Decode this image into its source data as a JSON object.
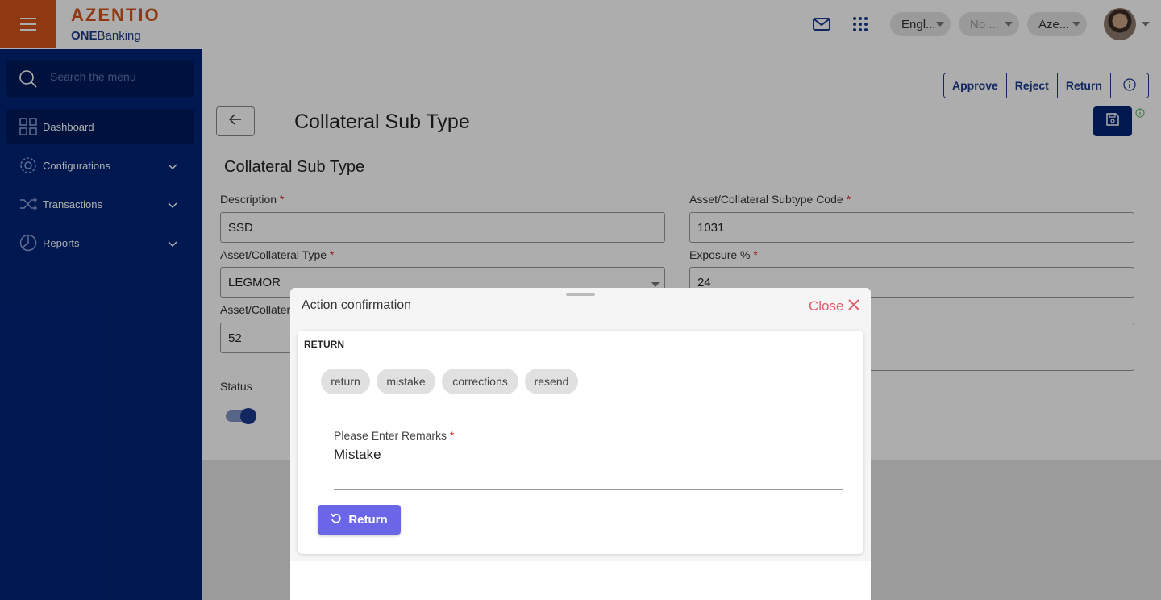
{
  "header": {
    "logo_main": "AZENTIO",
    "logo_sub_bold": "ONE",
    "logo_sub": "Banking",
    "icons": [
      "menu-icon",
      "mail-icon",
      "apps-grid-icon"
    ],
    "language": "Engl...",
    "no_dropdown": "No ...",
    "entity": "Aze..."
  },
  "sidebar": {
    "search_placeholder": "Search the menu",
    "items": [
      {
        "label": "Dashboard",
        "icon": "dashboard-icon"
      },
      {
        "label": "Configurations",
        "icon": "gear-icon"
      },
      {
        "label": "Transactions",
        "icon": "shuffle-icon"
      },
      {
        "label": "Reports",
        "icon": "pie-chart-icon"
      }
    ]
  },
  "main": {
    "actions": [
      "Approve",
      "Reject",
      "Return"
    ],
    "page_title": "Collateral Sub Type",
    "section_title": "Collateral Sub Type",
    "fields": {
      "description": {
        "label": "Description",
        "value": "SSD"
      },
      "subtype_code": {
        "label": "Asset/Collateral Subtype Code",
        "value": "1031"
      },
      "collateral_type": {
        "label": "Asset/Collateral Type",
        "value": "LEGMOR"
      },
      "exposure": {
        "label": "Exposure %",
        "value": "24"
      },
      "asset_collateral": {
        "label": "Asset/Collater",
        "value": "52"
      },
      "status": {
        "label": "Status",
        "enabled": true
      }
    }
  },
  "dialog": {
    "title": "Action confirmation",
    "close_label": "Close",
    "card_title": "RETURN",
    "chips": [
      "return",
      "mistake",
      "corrections",
      "resend"
    ],
    "remarks_label": "Please Enter Remarks",
    "remarks_value": "Mistake",
    "submit_label": "Return"
  },
  "colors": {
    "brand_orange": "#d2541b",
    "sidebar_navy": "#002477",
    "primary_button": "#6b66e8",
    "close_red": "#e35b6b"
  }
}
